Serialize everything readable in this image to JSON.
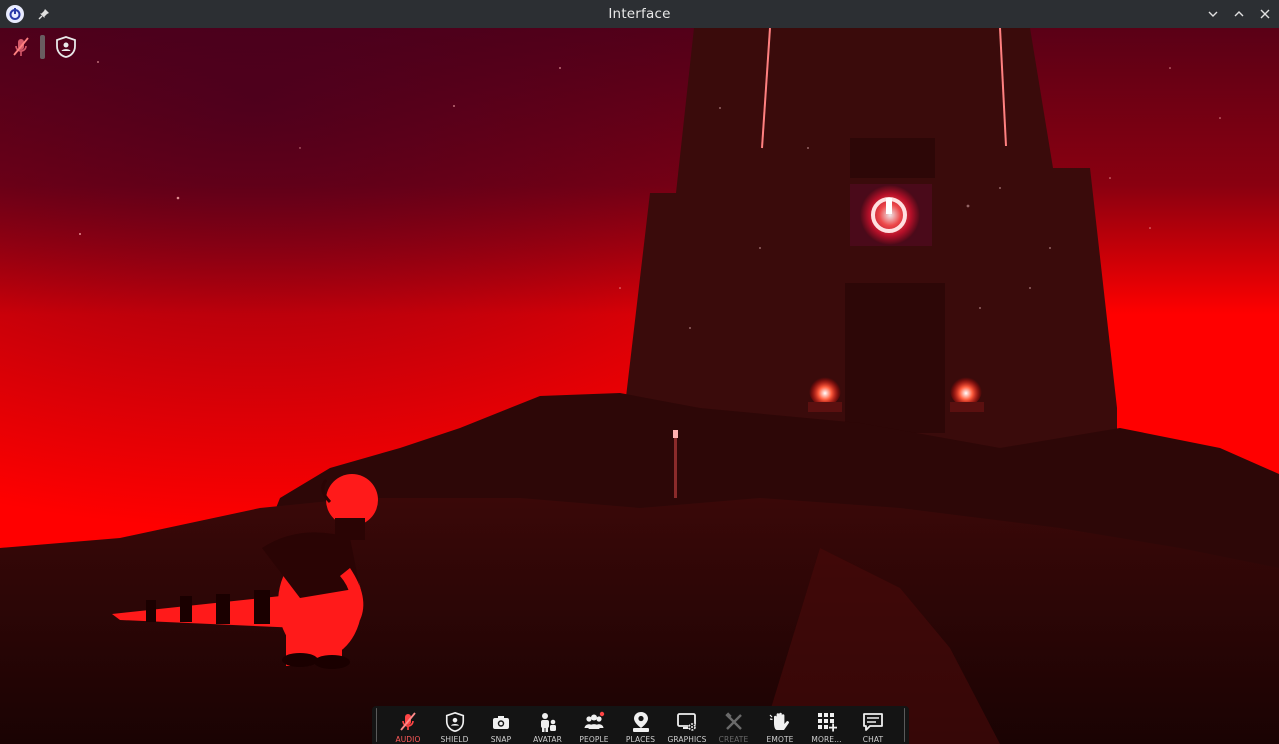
{
  "window": {
    "title": "Interface"
  },
  "toolbar": {
    "buttons": [
      {
        "label": "AUDIO",
        "icon": "audio-muted-icon",
        "state": "active"
      },
      {
        "label": "SHIELD",
        "icon": "shield-icon",
        "state": "normal"
      },
      {
        "label": "SNAP",
        "icon": "camera-icon",
        "state": "normal"
      },
      {
        "label": "AVATAR",
        "icon": "avatar-icon",
        "state": "normal"
      },
      {
        "label": "PEOPLE",
        "icon": "people-icon",
        "state": "normal"
      },
      {
        "label": "PLACES",
        "icon": "places-icon",
        "state": "normal"
      },
      {
        "label": "GRAPHICS",
        "icon": "graphics-icon",
        "state": "normal"
      },
      {
        "label": "CREATE",
        "icon": "create-icon",
        "state": "disabled"
      },
      {
        "label": "EMOTE",
        "icon": "hand-icon",
        "state": "normal"
      },
      {
        "label": "MORE...",
        "icon": "more-apps-icon",
        "state": "normal"
      },
      {
        "label": "CHAT",
        "icon": "chat-icon",
        "state": "normal"
      }
    ]
  },
  "colors": {
    "sky": "#ff0000",
    "ground": "#2a0606",
    "tower": "#3a0b0b",
    "toolbar_bg": "#141414",
    "titlebar_bg": "#2c2f33",
    "mute_accent": "#ff4545"
  }
}
